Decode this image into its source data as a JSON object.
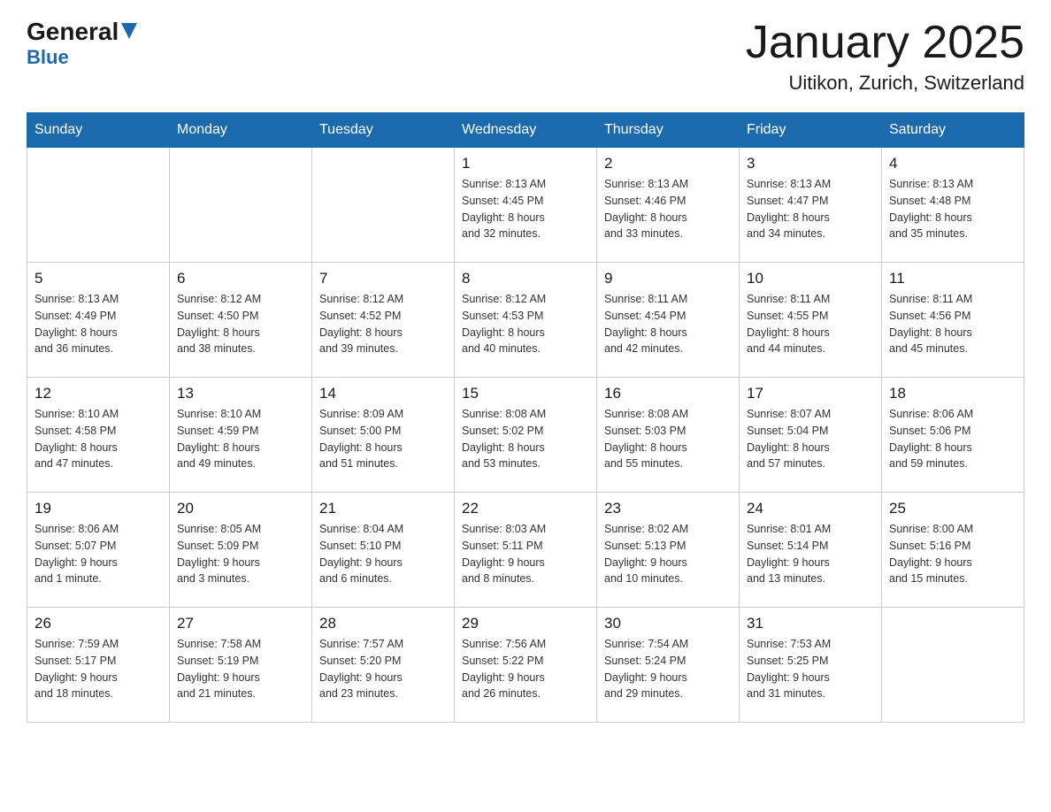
{
  "header": {
    "logo": {
      "general": "General",
      "blue": "Blue",
      "triangle_alt": "triangle"
    },
    "title": "January 2025",
    "location": "Uitikon, Zurich, Switzerland"
  },
  "calendar": {
    "days_of_week": [
      "Sunday",
      "Monday",
      "Tuesday",
      "Wednesday",
      "Thursday",
      "Friday",
      "Saturday"
    ],
    "weeks": [
      [
        {
          "day": "",
          "info": ""
        },
        {
          "day": "",
          "info": ""
        },
        {
          "day": "",
          "info": ""
        },
        {
          "day": "1",
          "info": "Sunrise: 8:13 AM\nSunset: 4:45 PM\nDaylight: 8 hours\nand 32 minutes."
        },
        {
          "day": "2",
          "info": "Sunrise: 8:13 AM\nSunset: 4:46 PM\nDaylight: 8 hours\nand 33 minutes."
        },
        {
          "day": "3",
          "info": "Sunrise: 8:13 AM\nSunset: 4:47 PM\nDaylight: 8 hours\nand 34 minutes."
        },
        {
          "day": "4",
          "info": "Sunrise: 8:13 AM\nSunset: 4:48 PM\nDaylight: 8 hours\nand 35 minutes."
        }
      ],
      [
        {
          "day": "5",
          "info": "Sunrise: 8:13 AM\nSunset: 4:49 PM\nDaylight: 8 hours\nand 36 minutes."
        },
        {
          "day": "6",
          "info": "Sunrise: 8:12 AM\nSunset: 4:50 PM\nDaylight: 8 hours\nand 38 minutes."
        },
        {
          "day": "7",
          "info": "Sunrise: 8:12 AM\nSunset: 4:52 PM\nDaylight: 8 hours\nand 39 minutes."
        },
        {
          "day": "8",
          "info": "Sunrise: 8:12 AM\nSunset: 4:53 PM\nDaylight: 8 hours\nand 40 minutes."
        },
        {
          "day": "9",
          "info": "Sunrise: 8:11 AM\nSunset: 4:54 PM\nDaylight: 8 hours\nand 42 minutes."
        },
        {
          "day": "10",
          "info": "Sunrise: 8:11 AM\nSunset: 4:55 PM\nDaylight: 8 hours\nand 44 minutes."
        },
        {
          "day": "11",
          "info": "Sunrise: 8:11 AM\nSunset: 4:56 PM\nDaylight: 8 hours\nand 45 minutes."
        }
      ],
      [
        {
          "day": "12",
          "info": "Sunrise: 8:10 AM\nSunset: 4:58 PM\nDaylight: 8 hours\nand 47 minutes."
        },
        {
          "day": "13",
          "info": "Sunrise: 8:10 AM\nSunset: 4:59 PM\nDaylight: 8 hours\nand 49 minutes."
        },
        {
          "day": "14",
          "info": "Sunrise: 8:09 AM\nSunset: 5:00 PM\nDaylight: 8 hours\nand 51 minutes."
        },
        {
          "day": "15",
          "info": "Sunrise: 8:08 AM\nSunset: 5:02 PM\nDaylight: 8 hours\nand 53 minutes."
        },
        {
          "day": "16",
          "info": "Sunrise: 8:08 AM\nSunset: 5:03 PM\nDaylight: 8 hours\nand 55 minutes."
        },
        {
          "day": "17",
          "info": "Sunrise: 8:07 AM\nSunset: 5:04 PM\nDaylight: 8 hours\nand 57 minutes."
        },
        {
          "day": "18",
          "info": "Sunrise: 8:06 AM\nSunset: 5:06 PM\nDaylight: 8 hours\nand 59 minutes."
        }
      ],
      [
        {
          "day": "19",
          "info": "Sunrise: 8:06 AM\nSunset: 5:07 PM\nDaylight: 9 hours\nand 1 minute."
        },
        {
          "day": "20",
          "info": "Sunrise: 8:05 AM\nSunset: 5:09 PM\nDaylight: 9 hours\nand 3 minutes."
        },
        {
          "day": "21",
          "info": "Sunrise: 8:04 AM\nSunset: 5:10 PM\nDaylight: 9 hours\nand 6 minutes."
        },
        {
          "day": "22",
          "info": "Sunrise: 8:03 AM\nSunset: 5:11 PM\nDaylight: 9 hours\nand 8 minutes."
        },
        {
          "day": "23",
          "info": "Sunrise: 8:02 AM\nSunset: 5:13 PM\nDaylight: 9 hours\nand 10 minutes."
        },
        {
          "day": "24",
          "info": "Sunrise: 8:01 AM\nSunset: 5:14 PM\nDaylight: 9 hours\nand 13 minutes."
        },
        {
          "day": "25",
          "info": "Sunrise: 8:00 AM\nSunset: 5:16 PM\nDaylight: 9 hours\nand 15 minutes."
        }
      ],
      [
        {
          "day": "26",
          "info": "Sunrise: 7:59 AM\nSunset: 5:17 PM\nDaylight: 9 hours\nand 18 minutes."
        },
        {
          "day": "27",
          "info": "Sunrise: 7:58 AM\nSunset: 5:19 PM\nDaylight: 9 hours\nand 21 minutes."
        },
        {
          "day": "28",
          "info": "Sunrise: 7:57 AM\nSunset: 5:20 PM\nDaylight: 9 hours\nand 23 minutes."
        },
        {
          "day": "29",
          "info": "Sunrise: 7:56 AM\nSunset: 5:22 PM\nDaylight: 9 hours\nand 26 minutes."
        },
        {
          "day": "30",
          "info": "Sunrise: 7:54 AM\nSunset: 5:24 PM\nDaylight: 9 hours\nand 29 minutes."
        },
        {
          "day": "31",
          "info": "Sunrise: 7:53 AM\nSunset: 5:25 PM\nDaylight: 9 hours\nand 31 minutes."
        },
        {
          "day": "",
          "info": ""
        }
      ]
    ]
  }
}
